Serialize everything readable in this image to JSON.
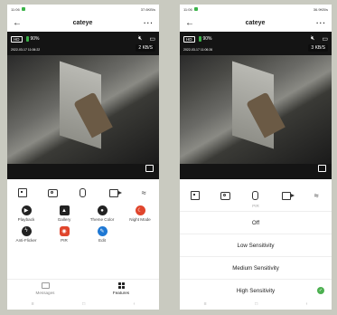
{
  "left": {
    "status": {
      "time": "11:06",
      "right": "37.6KB/s"
    },
    "title": "cateye",
    "video": {
      "hd": "HD",
      "battery": "90%",
      "timestamp": "2022-03-17 11:06:22",
      "speed": "2 KB/S"
    },
    "features": [
      {
        "label": "Playback",
        "icon": "play-icon",
        "color": "#222222"
      },
      {
        "label": "Gallery",
        "icon": "gallery-icon",
        "color": "#222222"
      },
      {
        "label": "Theme Color",
        "icon": "palette-icon",
        "color": "#222222"
      },
      {
        "label": "Night Mode",
        "icon": "night-mode-icon",
        "color": "#e0452c"
      },
      {
        "label": "Anti-Flicker",
        "icon": "anti-flicker-icon",
        "color": "#222222"
      },
      {
        "label": "PIR",
        "icon": "pir-icon",
        "color": "#e0452c"
      },
      {
        "label": "Edit",
        "icon": "edit-icon",
        "color": "#1e78d4"
      }
    ],
    "nav": {
      "messages": "Messages",
      "features": "Features"
    }
  },
  "right": {
    "status": {
      "time": "11:06",
      "right": "36.9KB/s"
    },
    "title": "cateye",
    "video": {
      "hd": "HD",
      "battery": "90%",
      "timestamp": "2022-03-17 11:06:26",
      "speed": "3 KB/S"
    },
    "pir": {
      "title": "PIR",
      "options": [
        "Off",
        "Low Sensitivity",
        "Medium Sensitivity",
        "High Sensitivity"
      ],
      "selected": "High Sensitivity"
    }
  },
  "colors": {
    "accent_green": "#4cb050",
    "accent_red": "#e0452c",
    "accent_blue": "#1e78d4"
  }
}
